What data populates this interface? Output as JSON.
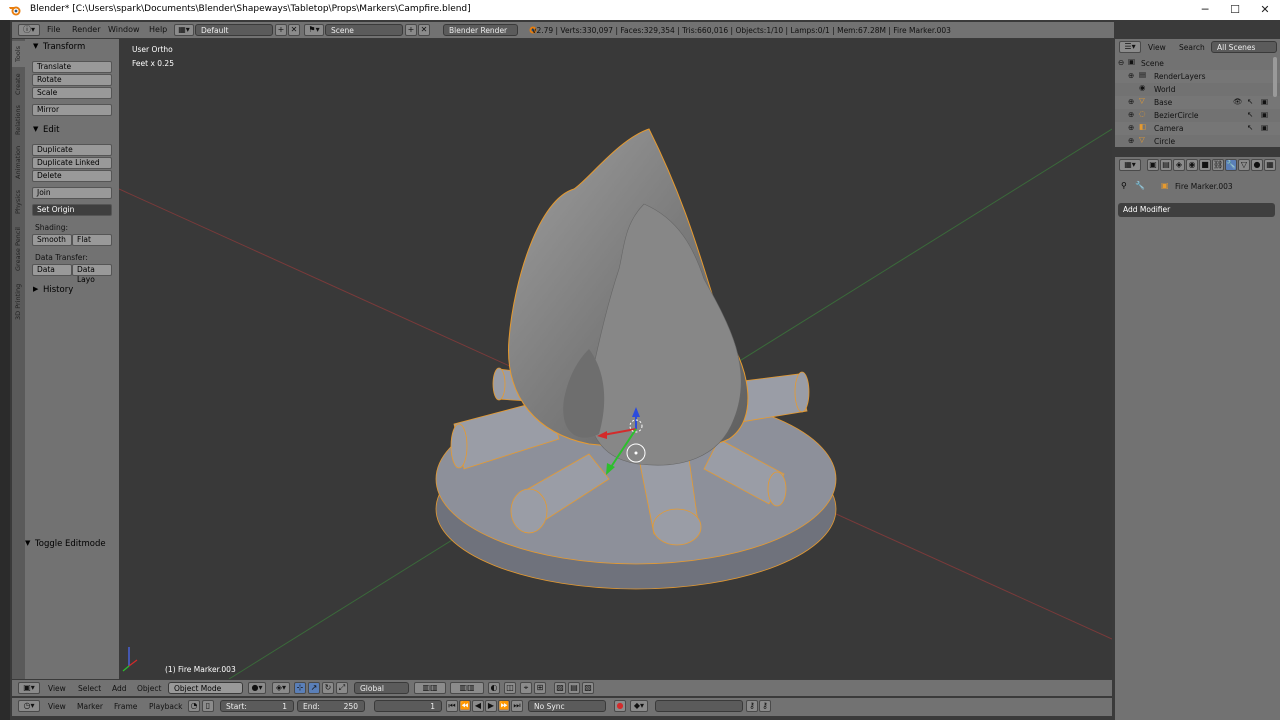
{
  "window": {
    "title": "Blender* [C:\\Users\\spark\\Documents\\Blender\\Shapeways\\Tabletop\\Props\\Markers\\Campfire.blend]",
    "minimize": "─",
    "maximize": "☐",
    "close": "✕"
  },
  "info_header": {
    "menus": [
      "File",
      "Render",
      "Window",
      "Help"
    ],
    "layout": "Default",
    "scene": "Scene",
    "engine": "Blender Render",
    "stats": "v2.79 | Verts:330,097 | Faces:329,354 | Tris:660,016 | Objects:1/10 | Lamps:0/1 | Mem:67.28M | Fire Marker.003"
  },
  "tool_tabs": [
    "Tools",
    "Create",
    "Relations",
    "Animation",
    "Physics",
    "Grease Pencil",
    "3D Printing"
  ],
  "tool_shelf": {
    "transform_title": "Transform",
    "translate": "Translate",
    "rotate": "Rotate",
    "scale": "Scale",
    "mirror": "Mirror",
    "edit_title": "Edit",
    "duplicate": "Duplicate",
    "duplicate_linked": "Duplicate Linked",
    "delete": "Delete",
    "join": "Join",
    "set_origin": "Set Origin",
    "shading_label": "Shading:",
    "smooth": "Smooth",
    "flat": "Flat",
    "data_transfer_label": "Data Transfer:",
    "data": "Data",
    "data_layout": "Data Layo",
    "history_title": "History",
    "toggle_editmode": "Toggle Editmode"
  },
  "viewport": {
    "view_name": "User Ortho",
    "scale": "Feet x 0.25",
    "active_object": "(1) Fire Marker.003"
  },
  "view3d_header": {
    "menus": [
      "View",
      "Select",
      "Add",
      "Object"
    ],
    "mode": "Object Mode",
    "orientation": "Global"
  },
  "timeline_header": {
    "menus": [
      "View",
      "Marker",
      "Frame",
      "Playback"
    ],
    "start_label": "Start:",
    "start_value": "1",
    "end_label": "End:",
    "end_value": "250",
    "current_frame": "1",
    "sync": "No Sync"
  },
  "outliner": {
    "header_view": "View",
    "header_search": "Search",
    "header_filter": "All Scenes",
    "items": [
      {
        "label": "Scene"
      },
      {
        "label": "RenderLayers"
      },
      {
        "label": "World"
      },
      {
        "label": "Base"
      },
      {
        "label": "BezierCircle"
      },
      {
        "label": "Camera"
      },
      {
        "label": "Circle"
      }
    ]
  },
  "properties": {
    "object_name": "Fire Marker.003",
    "add_modifier": "Add Modifier"
  },
  "colors": {
    "panel": "#727272",
    "viewport": "#393939",
    "button": "#999999",
    "dark_button": "#3f3f3f",
    "selection": "#e69a2f"
  }
}
